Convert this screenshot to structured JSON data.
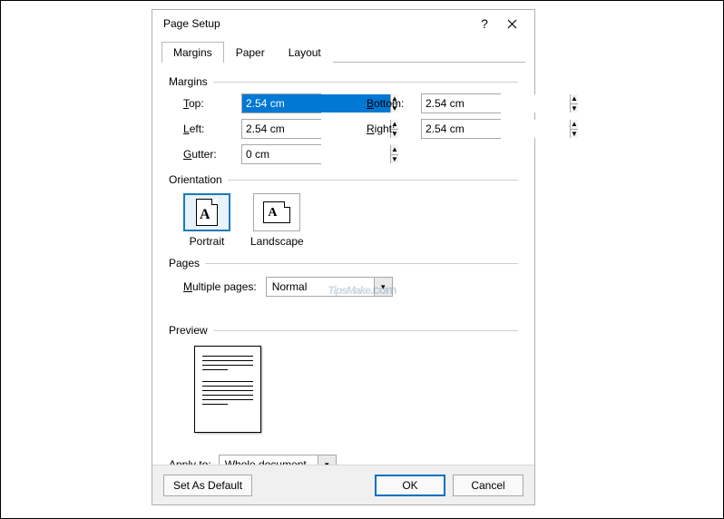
{
  "dialog": {
    "title": "Page Setup"
  },
  "tabs": {
    "margins": "Margins",
    "paper": "Paper",
    "layout": "Layout"
  },
  "sections": {
    "margins": "Margins",
    "orientation": "Orientation",
    "pages": "Pages",
    "preview": "Preview"
  },
  "margins": {
    "top_label": "Top:",
    "top_value": "2.54 cm",
    "bottom_label": "Bottom:",
    "bottom_value": "2.54 cm",
    "left_label": "Left:",
    "left_value": "2.54 cm",
    "right_label": "Right:",
    "right_value": "2.54 cm",
    "gutter_label": "Gutter:",
    "gutter_value": "0 cm"
  },
  "orientation": {
    "portrait": "Portrait",
    "landscape": "Landscape"
  },
  "pages": {
    "multiple_label": "Multiple pages:",
    "multiple_value": "Normal"
  },
  "apply": {
    "label": "Apply to:",
    "value": "Whole document"
  },
  "buttons": {
    "set_default": "Set As Default",
    "ok": "OK",
    "cancel": "Cancel"
  },
  "watermark": {
    "brand": "TipsMake",
    "suffix": ".com"
  }
}
